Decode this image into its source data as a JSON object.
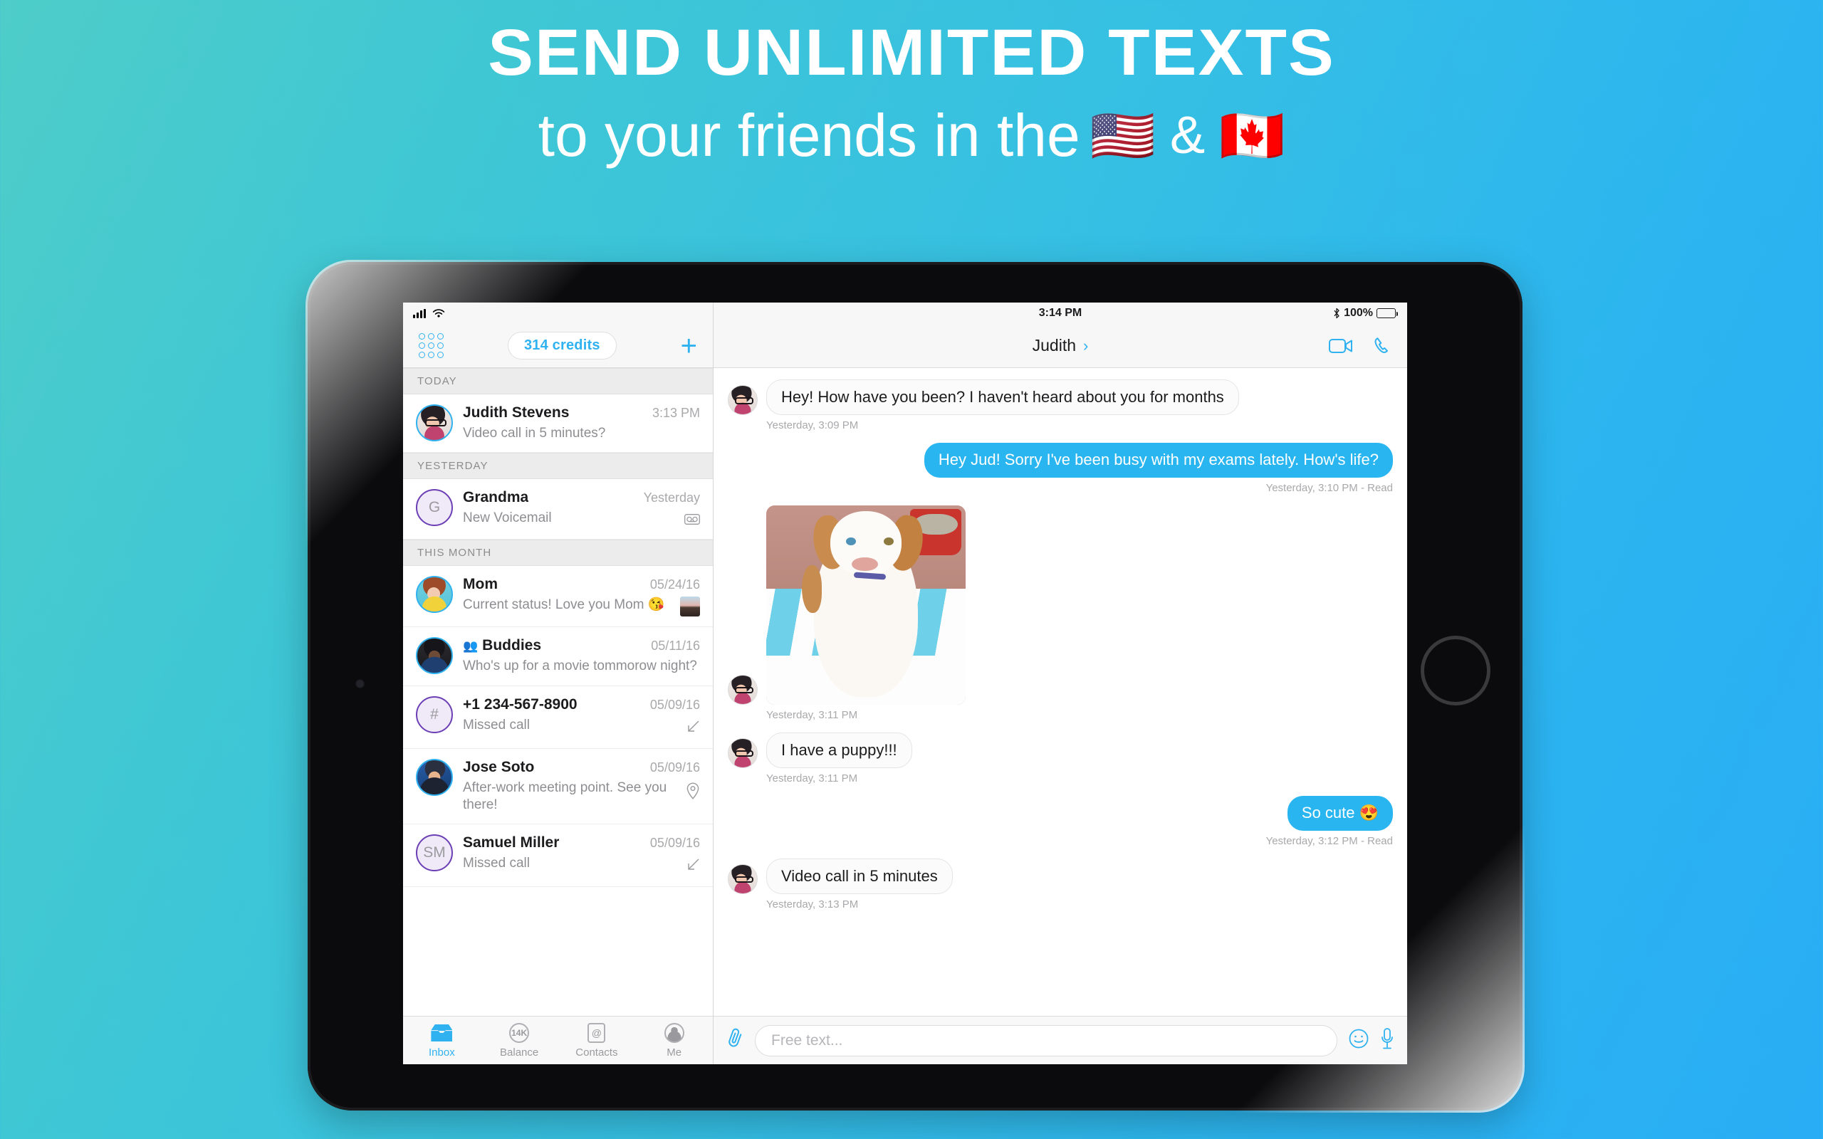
{
  "promo": {
    "line1": "SEND UNLIMITED TEXTS",
    "line2_prefix": "to your friends in the",
    "flag_us": "🇺🇸",
    "ampersand": "&",
    "flag_ca": "🇨🇦"
  },
  "status_left": {
    "signal_icon": "signal-bars-icon",
    "wifi_icon": "wifi-icon"
  },
  "status_right": {
    "clock": "3:14 PM",
    "bluetooth_icon": "bluetooth-icon",
    "battery_pct": "100%"
  },
  "left_toolbar": {
    "grid_icon": "dialpad-grid-icon",
    "credits": "314 credits",
    "add_icon": "plus-icon"
  },
  "conversations": [
    {
      "section": "TODAY",
      "items": [
        {
          "name": "Judith Stevens",
          "time": "3:13 PM",
          "preview": "Video call in 5 minutes?",
          "avatar_kind": "photo-judith",
          "avatar_initial": "",
          "meta_icon": ""
        }
      ]
    },
    {
      "section": "YESTERDAY",
      "items": [
        {
          "name": "Grandma",
          "time": "Yesterday",
          "preview": "New Voicemail",
          "avatar_kind": "initial-purple",
          "avatar_initial": "G",
          "meta_icon": "voicemail-icon"
        }
      ]
    },
    {
      "section": "THIS MONTH",
      "items": [
        {
          "name": "Mom",
          "time": "05/24/16",
          "preview": "Current status! Love you Mom 😘",
          "avatar_kind": "photo-mom",
          "avatar_initial": "",
          "meta_icon": "photo-thumbnail"
        },
        {
          "name": "Buddies",
          "time": "05/11/16",
          "preview": "Who's up for a movie tommorow night?",
          "avatar_kind": "photo-buddies",
          "avatar_initial": "",
          "meta_icon": "",
          "group": true
        },
        {
          "name": "+1 234-567-8900",
          "time": "05/09/16",
          "preview": "Missed call",
          "avatar_kind": "initial-purple",
          "avatar_initial": "#",
          "meta_icon": "missed-call-arrow-icon"
        },
        {
          "name": "Jose Soto",
          "time": "05/09/16",
          "preview": "After-work meeting point. See you there!",
          "avatar_kind": "photo-jose",
          "avatar_initial": "",
          "meta_icon": "location-pin-icon"
        },
        {
          "name": "Samuel Miller",
          "time": "05/09/16",
          "preview": "Missed call",
          "avatar_kind": "initial-purple",
          "avatar_initial": "SM",
          "meta_icon": "missed-call-arrow-icon"
        }
      ]
    }
  ],
  "tabs": [
    {
      "label": "Inbox",
      "icon": "inbox-icon",
      "active": true
    },
    {
      "label": "Balance",
      "icon": "balance-icon",
      "badge": "14K",
      "active": false
    },
    {
      "label": "Contacts",
      "icon": "contacts-icon",
      "active": false
    },
    {
      "label": "Me",
      "icon": "person-icon",
      "active": false
    }
  ],
  "chat": {
    "title": "Judith",
    "chevron_icon": "chevron-right-icon",
    "video_call_icon": "video-camera-icon",
    "voice_call_icon": "phone-icon",
    "messages": [
      {
        "dir": "in",
        "type": "text",
        "text": "Hey! How have you been? I haven't heard about you for months",
        "stamp": "Yesterday, 3:09 PM"
      },
      {
        "dir": "out",
        "type": "text",
        "text": "Hey Jud! Sorry I've been busy with my exams lately. How's life?",
        "stamp": "Yesterday, 3:10 PM - Read"
      },
      {
        "dir": "in",
        "type": "photo",
        "text": "",
        "alt": "puppy-photo",
        "stamp": "Yesterday, 3:11 PM"
      },
      {
        "dir": "in",
        "type": "text",
        "text": "I have a puppy!!!",
        "stamp": "Yesterday, 3:11 PM"
      },
      {
        "dir": "out",
        "type": "text",
        "text": "So cute 😍",
        "stamp": "Yesterday, 3:12 PM - Read"
      },
      {
        "dir": "in",
        "type": "text",
        "text": "Video call in 5 minutes",
        "stamp": "Yesterday, 3:13 PM"
      }
    ],
    "composer": {
      "attach_icon": "paperclip-icon",
      "placeholder": "Free text...",
      "emoji_icon": "smiley-icon",
      "mic_icon": "microphone-icon",
      "value": ""
    }
  },
  "colors": {
    "accent": "#2fb2ef",
    "bubble_out": "#28b5f0",
    "purple": "#6c3fb5",
    "bg_gradient_start": "#4ecdc9",
    "bg_gradient_end": "#29adf5"
  }
}
